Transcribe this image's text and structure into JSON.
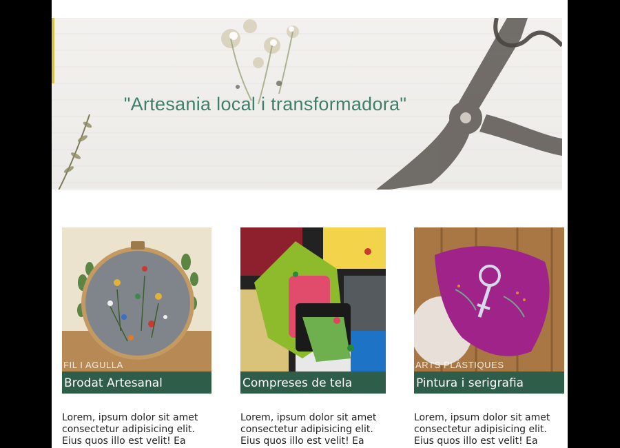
{
  "hero": {
    "title": "\"Artesania local i transformadora\""
  },
  "cards": [
    {
      "category": "FIL I AGULLA",
      "title": "Brodat Artesanal",
      "text": "Lorem, ipsum dolor sit amet consectetur adipisicing elit. Eius quos illo est velit! Ea suscipit"
    },
    {
      "category": "",
      "title": "Compreses de tela",
      "text": "Lorem, ipsum dolor sit amet consectetur adipisicing elit. Eius quos illo est velit! Ea"
    },
    {
      "category": "ARTS PLÀSTIQUES",
      "title": "Pintura i serigrafia",
      "text": "Lorem, ipsum dolor sit amet consectetur adipisicing elit. Eius quos illo est velit! Ea suscipit"
    }
  ],
  "colors": {
    "accent_band": "#2e5e49",
    "hero_title": "#3e7f6c",
    "page_background": "#ffffff",
    "outer_background": "#000000"
  },
  "images": {
    "hero": "hero-wood-scissors-image",
    "card1": "embroidery-hoop-image",
    "card2": "cloth-pads-image",
    "card3": "painted-mask-image"
  }
}
